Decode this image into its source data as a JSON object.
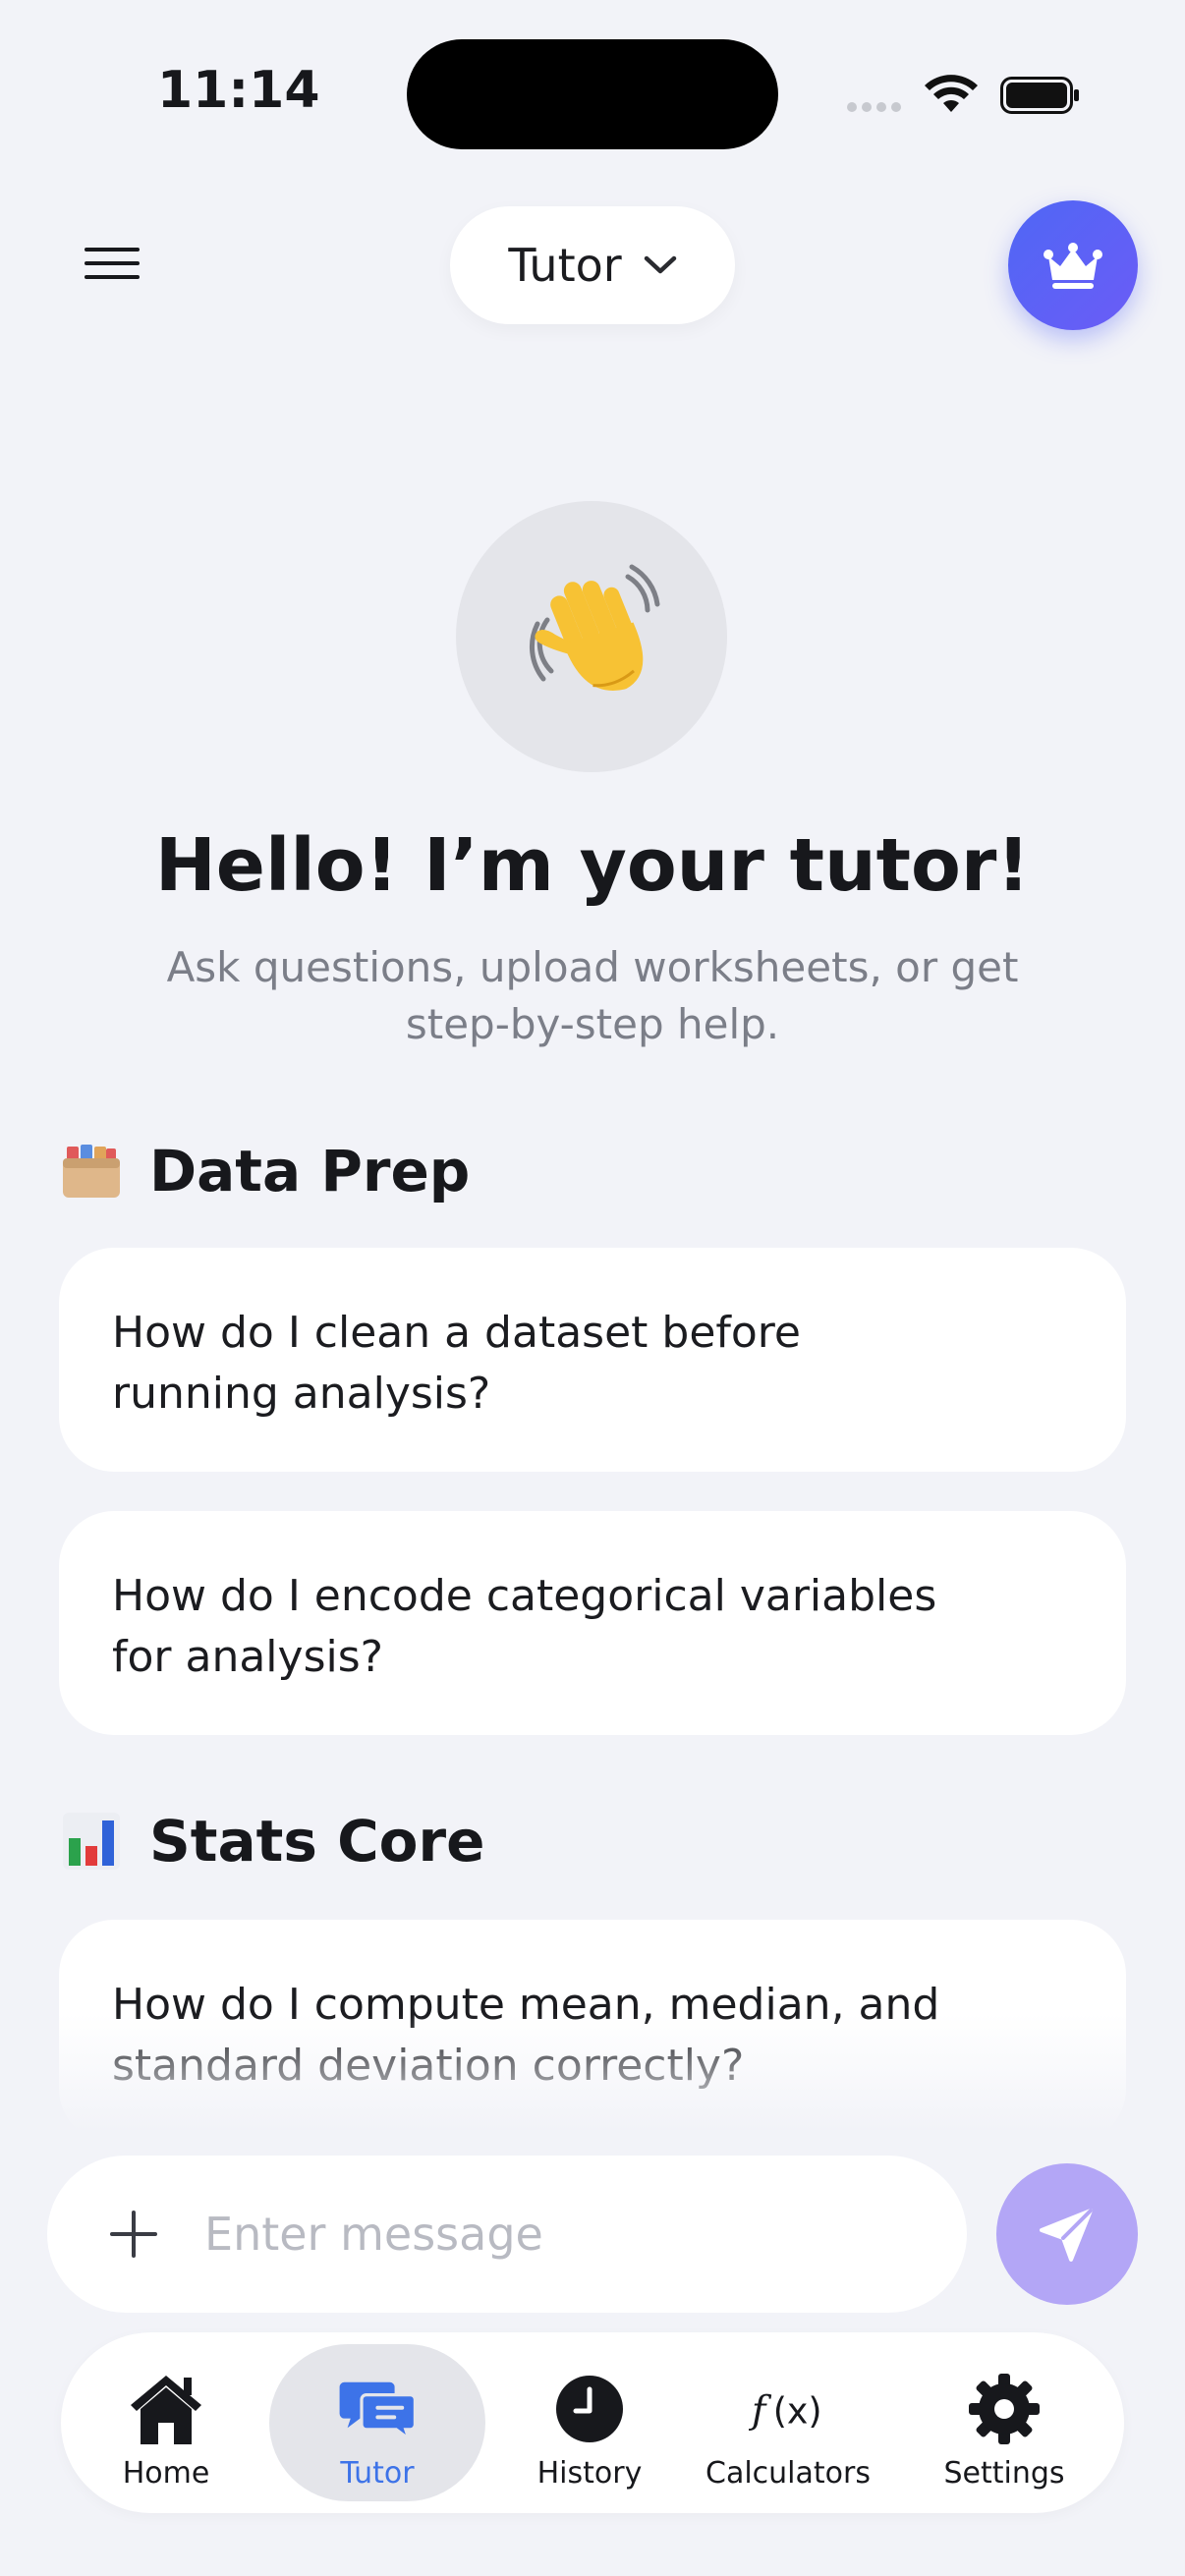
{
  "status_bar": {
    "time": "11:14"
  },
  "header": {
    "model_label": "Tutor"
  },
  "hero": {
    "title": "Hello! I’m your tutor!",
    "subtitle": "Ask questions, upload worksheets, or get step-by-step help."
  },
  "sections": [
    {
      "title": "Data Prep",
      "icon": "card-file-box-icon",
      "prompts": [
        "How do I clean a dataset before running analysis?",
        "How do I encode categorical variables for analysis?"
      ]
    },
    {
      "title": "Stats Core",
      "icon": "bar-chart-icon",
      "prompts": [
        "How do I compute mean, median, and standard deviation correctly?"
      ]
    }
  ],
  "composer": {
    "placeholder": "Enter message"
  },
  "tabs": [
    {
      "label": "Home",
      "icon": "home-icon"
    },
    {
      "label": "Tutor",
      "icon": "chat-bubbles-icon",
      "active": true
    },
    {
      "label": "History",
      "icon": "clock-icon"
    },
    {
      "label": "Calculators",
      "icon": "function-icon"
    },
    {
      "label": "Settings",
      "icon": "gear-icon"
    }
  ],
  "colors": {
    "accent": "#5b63f5",
    "send_button": "#b3a6f6",
    "active_tab_text": "#3d73e8",
    "background": "#f2f3f8"
  }
}
